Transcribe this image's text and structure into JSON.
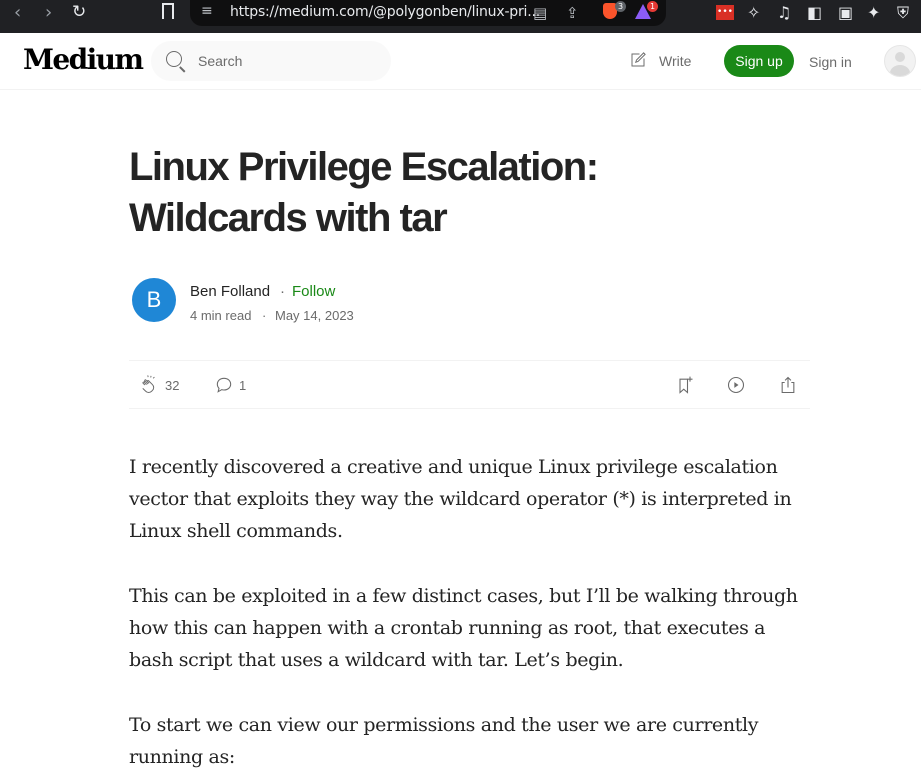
{
  "browser": {
    "url": "https://medium.com/@polygonben/linux-pri...",
    "brave_badge": "3",
    "alert_badge": "1"
  },
  "header": {
    "logo": "Medium",
    "search_placeholder": "Search",
    "write_label": "Write",
    "signup_label": "Sign up",
    "signin_label": "Sign in"
  },
  "article": {
    "title": "Linux Privilege Escalation: Wildcards with tar",
    "author": {
      "initial": "B",
      "name": "Ben Folland",
      "separator": "·",
      "follow_label": "Follow",
      "read_time": "4 min read",
      "meta_separator": "·",
      "date": "May 14, 2023"
    },
    "actions": {
      "claps": "32",
      "responses": "1"
    },
    "paragraphs": [
      "I recently discovered a creative and unique Linux privilege escalation vector that exploits they way the wildcard operator (*) is interpreted in Linux shell commands.",
      "This can be exploited in a few distinct cases, but I’ll be walking through how this can happen with a crontab running as root, that executes a bash script that uses a wildcard with tar. Let’s begin.",
      "To start we can view our permissions and the user we are currently running as:"
    ]
  },
  "colors": {
    "accent_green": "#1a8917",
    "author_avatar_blue": "#1f87d6",
    "text": "#242424",
    "muted": "#6b6b6b"
  }
}
